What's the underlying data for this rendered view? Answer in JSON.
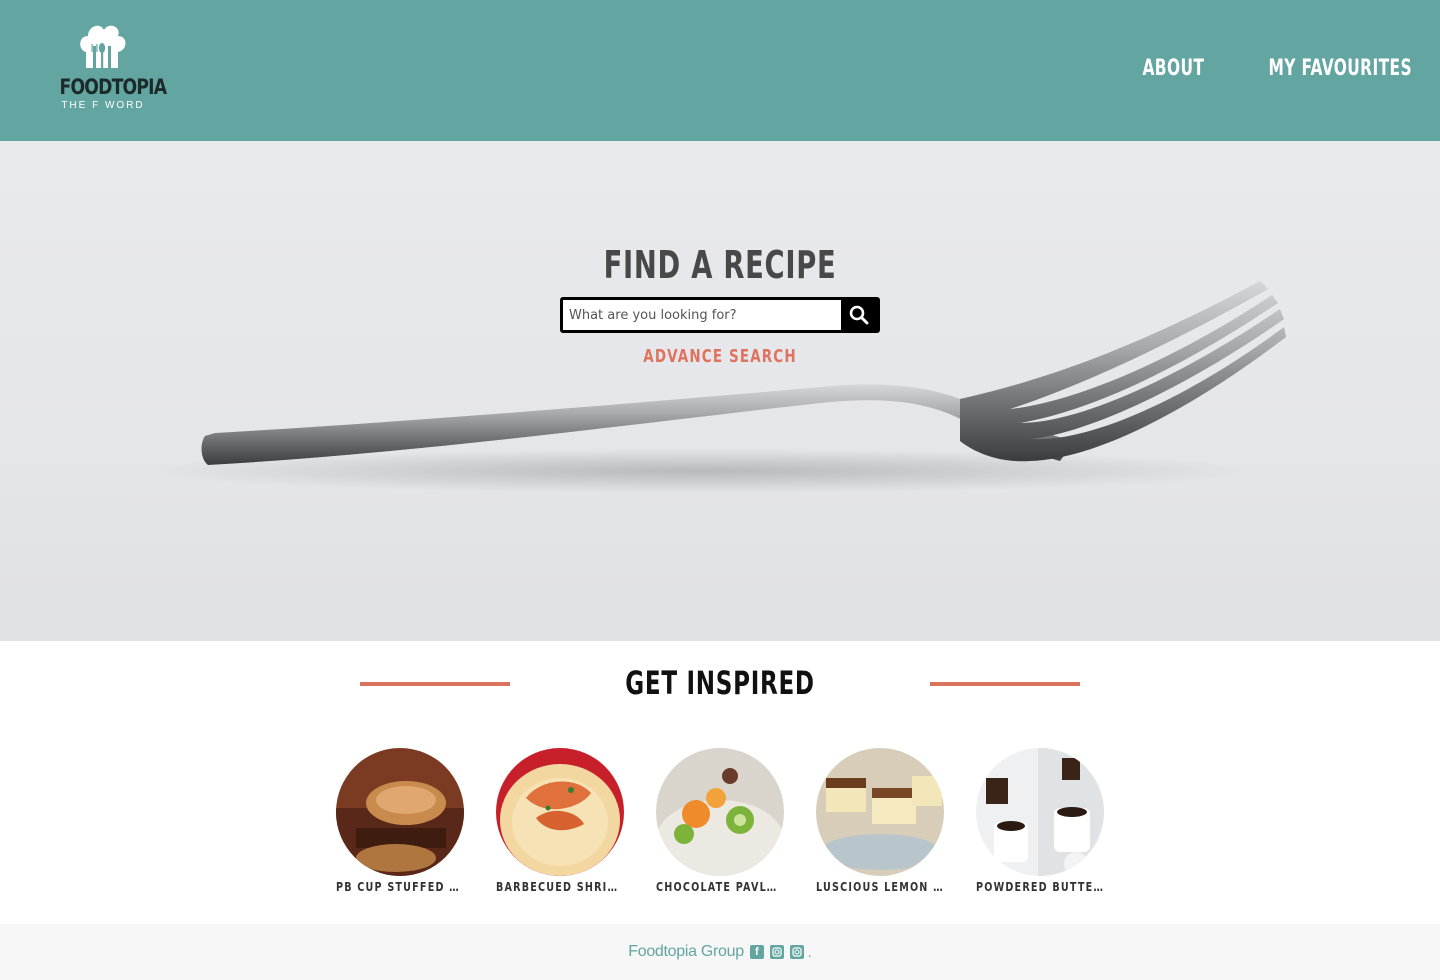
{
  "brand": {
    "name": "FOODTOPIA",
    "tagline": "THE F WORD"
  },
  "nav": {
    "items": [
      {
        "label": "ABOUT"
      },
      {
        "label": "MY FAVOURITES"
      }
    ]
  },
  "hero": {
    "title": "FIND A RECIPE",
    "search_placeholder": "What are you looking for?",
    "search_icon": "search-icon",
    "advance_search": "ADVANCE SEARCH"
  },
  "inspired": {
    "title": "GET INSPIRED",
    "recipes": [
      {
        "label": "PB CUP STUFFED BROWNIES"
      },
      {
        "label": "BARBECUED SHRIMP AND GRITS"
      },
      {
        "label": "CHOCOLATE PAVLOVA"
      },
      {
        "label": "LUSCIOUS LEMON BARS"
      },
      {
        "label": "POWDERED BUTTER COOKIES"
      }
    ]
  },
  "footer": {
    "text": "Foodtopia Group",
    "icons": [
      "facebook-icon",
      "instagram-icon",
      "instagram-icon"
    ],
    "trailing": "."
  },
  "colors": {
    "header": "#63a5a1",
    "accent": "#e0735f",
    "footer_bg": "#f7f7f7"
  }
}
